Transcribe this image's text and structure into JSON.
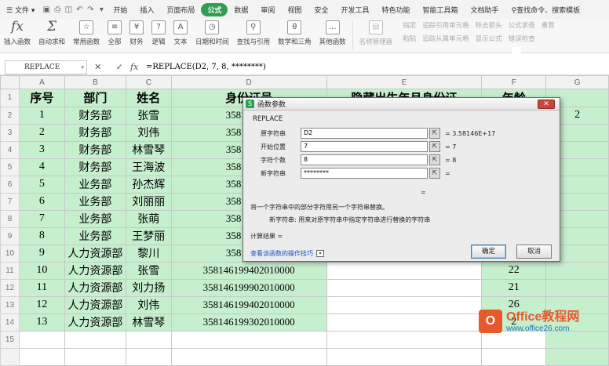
{
  "menubar": {
    "file": "文件",
    "tabs": [
      "开始",
      "插入",
      "页面布局",
      "公式",
      "数据",
      "审阅",
      "视图",
      "安全",
      "开发工具",
      "特色功能",
      "智能工具箱",
      "文档助手"
    ],
    "active_tab": "公式",
    "search": "查找命令、搜索模板"
  },
  "ribbon": {
    "insert_function": "插入函数",
    "autosum": "自动求和",
    "common": "常用函数",
    "all": "全部",
    "finance": "财务",
    "logic": "逻辑",
    "text": "文本",
    "datetime": "日期和时间",
    "lookup": "查找与引用",
    "math": "数学和三角",
    "other": "其他函数",
    "name_manager": "名称管理器",
    "paste": "粘贴",
    "specify": "指定",
    "trace_precedents": "追踪引用单元格",
    "trace_dependents": "追踪从属单元格",
    "remove_arrows": "移去箭头",
    "show_formulas": "显示公式",
    "recalc": "公式求值",
    "error_check": "错误检查",
    "recalc2": "重算"
  },
  "formula_bar": {
    "name_box": "REPLACE",
    "fx": "fx",
    "formula": "=REPLACE(D2, 7, 8, ********)"
  },
  "sheet": {
    "columns": [
      "A",
      "B",
      "C",
      "D",
      "E",
      "F",
      "G"
    ],
    "headers": [
      "序号",
      "部门",
      "姓名",
      "身份证号",
      "隐藏出生年月身份证",
      "年龄"
    ],
    "rows": [
      [
        "1",
        "财务部",
        "张雪",
        "358146199",
        "",
        "",
        "2"
      ],
      [
        "2",
        "财务部",
        "刘伟",
        "358146199",
        "",
        "",
        ""
      ],
      [
        "3",
        "财务部",
        "林雪琴",
        "358146199",
        "",
        "",
        ""
      ],
      [
        "4",
        "财务部",
        "王海波",
        "358146199",
        "",
        "",
        ""
      ],
      [
        "5",
        "业务部",
        "孙杰辉",
        "358146199",
        "",
        "",
        ""
      ],
      [
        "6",
        "业务部",
        "刘丽丽",
        "358146199",
        "",
        "",
        ""
      ],
      [
        "7",
        "业务部",
        "张萌",
        "358146199",
        "",
        "",
        ""
      ],
      [
        "8",
        "业务部",
        "王梦丽",
        "358146199",
        "",
        "",
        ""
      ],
      [
        "9",
        "人力资源部",
        "黎川",
        "358146199",
        "",
        "",
        ""
      ],
      [
        "10",
        "人力资源部",
        "张雪",
        "358146199402010000",
        "",
        "22",
        ""
      ],
      [
        "11",
        "人力资源部",
        "刘力扬",
        "358146199902010000",
        "",
        "21",
        ""
      ],
      [
        "12",
        "人力资源部",
        "刘伟",
        "358146199402010000",
        "",
        "26",
        ""
      ],
      [
        "13",
        "人力资源部",
        "林雪琴",
        "358146199302010000",
        "",
        "2",
        ""
      ]
    ],
    "row_numbers": [
      "1",
      "2",
      "3",
      "4",
      "5",
      "6",
      "7",
      "8",
      "9",
      "10",
      "11",
      "12",
      "13",
      "14",
      "15"
    ]
  },
  "dialog": {
    "title": "函数参数",
    "function_name": "REPLACE",
    "args": [
      {
        "label": "原字符串",
        "value": "D2",
        "result": "= 3.58146E+17"
      },
      {
        "label": "开始位置",
        "value": "7",
        "result": "= 7"
      },
      {
        "label": "字符个数",
        "value": "8",
        "result": "= 8"
      },
      {
        "label": "新字符串",
        "value": "********",
        "result": "="
      }
    ],
    "eq_line": "=",
    "description": "将一个字符串中的部分字符用另一个字符串替换。",
    "param_desc": "新字符串:  用来对原字符串中指定字符串进行替换的字符串",
    "result_label": "计算结果 =",
    "help_link": "查看该函数的操作技巧",
    "ok": "确定",
    "cancel": "取消"
  },
  "watermark": {
    "brand": "Office教程网",
    "url": "www.office26.com"
  }
}
